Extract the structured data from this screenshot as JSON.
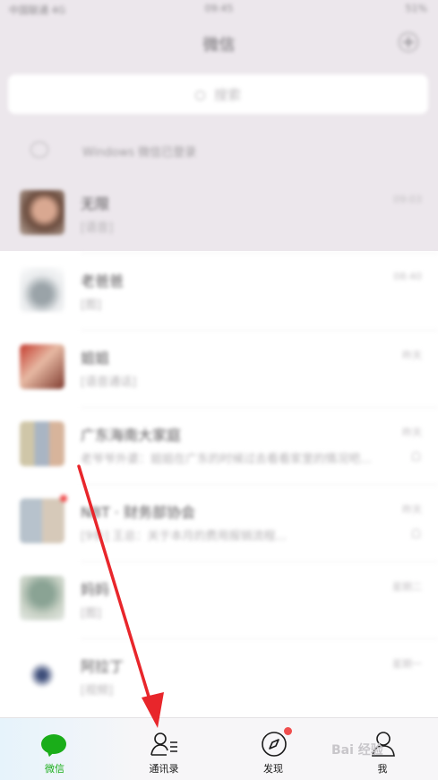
{
  "status_bar": {
    "carrier": "中国联通 4G",
    "time": "09:45",
    "battery": "51%"
  },
  "header": {
    "title": "微信",
    "add_icon": "plus-circle-icon"
  },
  "search": {
    "placeholder": "搜索"
  },
  "windows_login": {
    "text": "Windows 微信已登录"
  },
  "chats": [
    {
      "name": "无限",
      "message": "[语音]",
      "time": "09:03",
      "muted": false
    },
    {
      "name": "老爸爸",
      "message": "[图]",
      "time": "08:40",
      "muted": false
    },
    {
      "name": "姐姐",
      "message": "[语音通话]",
      "time": "昨天",
      "muted": false
    },
    {
      "name": "广东海南大家庭",
      "message": "老爷爷外婆：姐姐在广东的时候过去看看家里的情况吧...",
      "time": "昨天",
      "muted": true
    },
    {
      "name": "NBT · 财务部协会",
      "message": "[9条] 王总：关于本月的费用报销流程...",
      "time": "昨天",
      "muted": true
    },
    {
      "name": "妈妈",
      "message": "[图]",
      "time": "星期二",
      "muted": false
    },
    {
      "name": "阿拉丁",
      "message": "[视频]",
      "time": "星期一",
      "muted": false
    }
  ],
  "tab_bar": {
    "tabs": [
      {
        "label": "微信",
        "icon": "chat-bubble-icon",
        "active": true
      },
      {
        "label": "通讯录",
        "icon": "contacts-icon",
        "active": false
      },
      {
        "label": "发现",
        "icon": "compass-icon",
        "active": false,
        "badge": true
      },
      {
        "label": "我",
        "icon": "person-icon",
        "active": false
      }
    ]
  },
  "colors": {
    "accent": "#1aad19",
    "badge": "#f04e4e",
    "arrow": "#e8262b"
  },
  "watermark": "Bai 经验"
}
